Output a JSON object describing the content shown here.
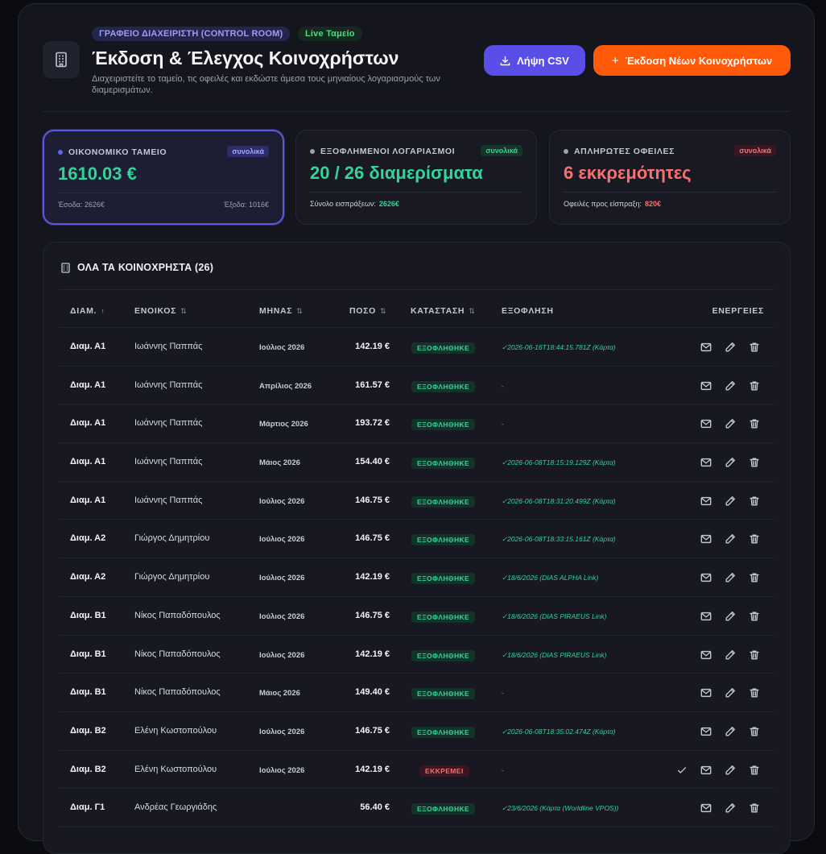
{
  "header": {
    "badge_control": "ΓΡΑΦΕΙΟ ΔΙΑΧΕΙΡΙΣΤΗ (CONTROL ROOM)",
    "badge_live": "Live Ταμείο",
    "title": "Έκδοση & Έλεγχος Κοινοχρήστων",
    "subtitle": "Διαχειριστείτε το ταμείο, τις οφειλές και εκδώστε άμεσα τους μηνιαίους λογαριασμούς των διαμερισμάτων.",
    "csv_label": "Λήψη CSV",
    "new_label": "Έκδοση Νέων Κοινοχρήστων"
  },
  "cards": {
    "fund": {
      "label": "ΟΙΚΟΝΟΜΙΚΟ ΤΑΜΕΙΟ",
      "tag": "συνολικά",
      "value": "1610.03 €",
      "income": "Έσοδα: 2626€",
      "expenses": "Έξοδα: 1016€"
    },
    "paid": {
      "label": "ΕΞΟΦΛΗΜΕΝΟΙ ΛΟΓΑΡΙΑΣΜΟΙ",
      "tag": "συνολικά",
      "value": "20 / 26 διαμερίσματα",
      "foot_label": "Σύνολο εισπράξεων:",
      "foot_value": "2626€"
    },
    "unpaid": {
      "label": "ΑΠΛΗΡΩΤΕΣ ΟΦΕΙΛΕΣ",
      "tag": "συνολικά",
      "value": "6 εκκρεμότητες",
      "foot_label": "Οφειλές προς είσπραξη:",
      "foot_value": "820€"
    }
  },
  "colors": {
    "accent": "#5a4ee8",
    "cta": "#ff5a0a",
    "fund": "#34d399",
    "debt": "#f87171"
  },
  "table": {
    "title": "ΟΛΑ ΤΑ ΚΟΙΝΟΧΡΗΣΤΑ (26)",
    "columns": {
      "apt": "ΔΙΑΜ.",
      "tenant": "ΕΝΟΙΚΟΣ",
      "month": "ΜΗΝΑΣ",
      "amount": "ΠΟΣΟ",
      "status": "ΚΑΤΑΣΤΑΣΗ",
      "payment": "ΕΞΟΦΛΗΣΗ",
      "actions": "ΕΝΕΡΓΕΙΕΣ"
    },
    "rows": [
      {
        "apt": "Διαμ. Α1",
        "tenant": "Ιωάννης Παππάς",
        "month": "Ιούλιος 2026",
        "amount": "142.19 €",
        "status": "ΕΞΟΦΛΗΘΗΚΕ",
        "paid": true,
        "payment": "✓2026-06-16T18:44:15.781Z (Κάρτα)"
      },
      {
        "apt": "Διαμ. Α1",
        "tenant": "Ιωάννης Παππάς",
        "month": "Απρίλιος 2026",
        "amount": "161.57 €",
        "status": "ΕΞΟΦΛΗΘΗΚΕ",
        "paid": true,
        "payment": "-"
      },
      {
        "apt": "Διαμ. Α1",
        "tenant": "Ιωάννης Παππάς",
        "month": "Μάρτιος 2026",
        "amount": "193.72 €",
        "status": "ΕΞΟΦΛΗΘΗΚΕ",
        "paid": true,
        "payment": "-"
      },
      {
        "apt": "Διαμ. Α1",
        "tenant": "Ιωάννης Παππάς",
        "month": "Μάιος 2026",
        "amount": "154.40 €",
        "status": "ΕΞΟΦΛΗΘΗΚΕ",
        "paid": true,
        "payment": "✓2026-06-08T18:15:19.129Z (Κάρτα)"
      },
      {
        "apt": "Διαμ. Α1",
        "tenant": "Ιωάννης Παππάς",
        "month": "Ιούλιος 2026",
        "amount": "146.75 €",
        "status": "ΕΞΟΦΛΗΘΗΚΕ",
        "paid": true,
        "payment": "✓2026-06-08T18:31:20.499Z (Κάρτα)"
      },
      {
        "apt": "Διαμ. Α2",
        "tenant": "Γιώργος Δημητρίου",
        "month": "Ιούλιος 2026",
        "amount": "146.75 €",
        "status": "ΕΞΟΦΛΗΘΗΚΕ",
        "paid": true,
        "payment": "✓2026-06-08T18:33:15.161Z (Κάρτα)"
      },
      {
        "apt": "Διαμ. Α2",
        "tenant": "Γιώργος Δημητρίου",
        "month": "Ιούλιος 2026",
        "amount": "142.19 €",
        "status": "ΕΞΟΦΛΗΘΗΚΕ",
        "paid": true,
        "payment": "✓18/6/2026 (DIAS ALPHA Link)"
      },
      {
        "apt": "Διαμ. Β1",
        "tenant": "Νίκος Παπαδόπουλος",
        "month": "Ιούλιος 2026",
        "amount": "146.75 €",
        "status": "ΕΞΟΦΛΗΘΗΚΕ",
        "paid": true,
        "payment": "✓18/6/2026 (DIAS PIRAEUS Link)"
      },
      {
        "apt": "Διαμ. Β1",
        "tenant": "Νίκος Παπαδόπουλος",
        "month": "Ιούλιος 2026",
        "amount": "142.19 €",
        "status": "ΕΞΟΦΛΗΘΗΚΕ",
        "paid": true,
        "payment": "✓18/6/2026 (DIAS PIRAEUS Link)"
      },
      {
        "apt": "Διαμ. Β1",
        "tenant": "Νίκος Παπαδόπουλος",
        "month": "Μάιος 2026",
        "amount": "149.40 €",
        "status": "ΕΞΟΦΛΗΘΗΚΕ",
        "paid": true,
        "payment": "-"
      },
      {
        "apt": "Διαμ. Β2",
        "tenant": "Ελένη Κωστοπούλου",
        "month": "Ιούλιος 2026",
        "amount": "146.75 €",
        "status": "ΕΞΟΦΛΗΘΗΚΕ",
        "paid": true,
        "payment": "✓2026-06-08T18:35:02.474Z (Κάρτα)"
      },
      {
        "apt": "Διαμ. Β2",
        "tenant": "Ελένη Κωστοπούλου",
        "month": "Ιούλιος 2026",
        "amount": "142.19 €",
        "status": "ΕΚΚΡΕΜΕΙ",
        "paid": false,
        "payment": "-"
      },
      {
        "apt": "Διαμ. Γ1",
        "tenant": "Ανδρέας Γεωργιάδης",
        "month": "",
        "amount": "56.40 €",
        "status": "ΕΞΟΦΛΗΘΗΚΕ",
        "paid": true,
        "payment": "✓23/6/2026 (Κάρτα (Worldline VPOS))"
      }
    ]
  }
}
